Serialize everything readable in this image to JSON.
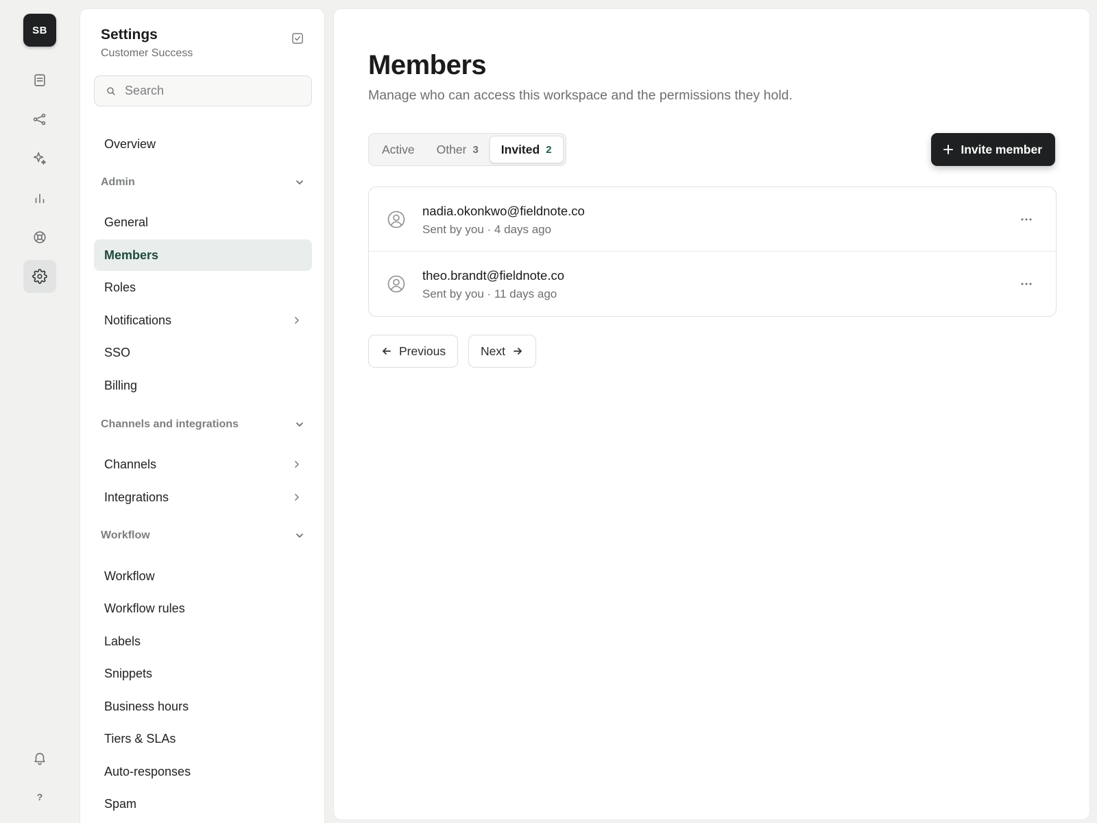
{
  "rail": {
    "logo_initials": "SB",
    "items": [
      {
        "icon": "document-icon",
        "label": ""
      },
      {
        "icon": "share-nodes-icon",
        "label": ""
      },
      {
        "icon": "sparkles-icon",
        "label": ""
      },
      {
        "icon": "bar-chart-icon",
        "label": ""
      },
      {
        "icon": "lifebuoy-icon",
        "label": ""
      },
      {
        "icon": "gear-icon",
        "label": "",
        "active": true
      }
    ],
    "bell_icon": "bell-icon",
    "help_label": "?"
  },
  "sidebar": {
    "title": "Settings",
    "subtitle": "Customer Success",
    "search": {
      "placeholder": "Search",
      "value": ""
    },
    "overview": "Overview",
    "sections": {
      "admin": {
        "label": "Admin",
        "items": [
          "General",
          "Members",
          "Roles",
          "Notifications",
          "SSO",
          "Billing"
        ]
      },
      "channels": {
        "label": "Channels and integrations",
        "items": [
          "Channels",
          "Integrations"
        ]
      },
      "workflow": {
        "label": "Workflow",
        "items": [
          "Workflow",
          "Workflow rules",
          "Labels",
          "Snippets",
          "Business hours",
          "Tiers & SLAs",
          "Auto-responses",
          "Spam"
        ]
      }
    },
    "active_item": "Members"
  },
  "main": {
    "title": "Members",
    "subtitle": "Manage who can access this workspace and the permissions they hold.",
    "tabs": [
      {
        "label": "Active",
        "count": ""
      },
      {
        "label": "Other",
        "count": "3"
      },
      {
        "label": "Invited",
        "count": "2",
        "active": true
      }
    ],
    "invite_button": "Invite member",
    "invites": [
      {
        "email": "nadia.okonkwo@fieldnote.co",
        "meta": "Sent by you · 4 days ago"
      },
      {
        "email": "theo.brandt@fieldnote.co",
        "meta": "Sent by you · 11 days ago"
      }
    ],
    "pagination": {
      "previous": "Previous",
      "next": "Next"
    }
  },
  "colors": {
    "accent_dark": "#1e2021",
    "active_nav_bg": "#e9eeec",
    "active_nav_text": "#1f4a3a",
    "background": "#f1f1f0"
  }
}
